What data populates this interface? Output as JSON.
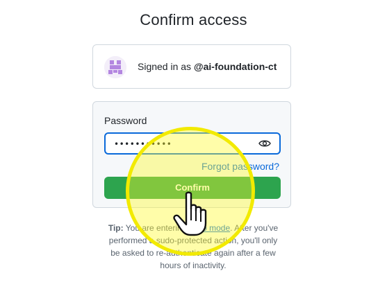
{
  "page": {
    "title": "Confirm access"
  },
  "account": {
    "signed_in_prefix": "Signed in as",
    "username": "@ai-foundation-ct",
    "avatar_icon": "identicon-avatar",
    "avatar_color": "#b386e0"
  },
  "form": {
    "password_label": "Password",
    "password_value": "•••••••••••",
    "show_password_icon": "eye-icon",
    "forgot_link": "Forgot password?",
    "confirm_label": "Confirm"
  },
  "tip": {
    "label": "Tip:",
    "text_before_link": "You are entering",
    "link_text": "sudo mode",
    "text_after_link": ". After you've performed a sudo-protected action, you'll only be asked to re-authenticate again after a few hours of inactivity."
  },
  "overlay": {
    "highlight_color": "#f2ea00",
    "cursor_icon": "hand-pointer-icon"
  },
  "colors": {
    "primary_button": "#2da44e",
    "link": "#0969da",
    "focus_border": "#0969da"
  }
}
